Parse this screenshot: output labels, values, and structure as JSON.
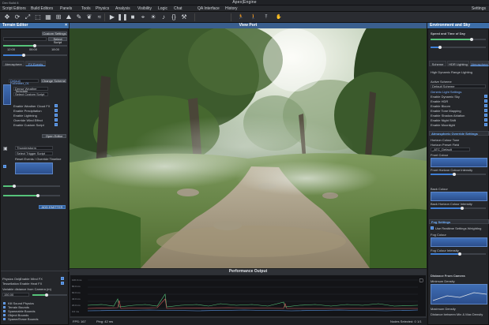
{
  "window": {
    "left_label": "Dev Build 8",
    "title": "Apex|Engine"
  },
  "menu": [
    "Script Editors",
    "Build Editors",
    "Panels",
    "Tools",
    "Physics",
    "Analysis",
    "Visibility",
    "Logic",
    "Chat",
    "QA Interface",
    "History"
  ],
  "menu_right": "Settings",
  "toolbar_icons": [
    "move-icon",
    "rotate-icon",
    "scale-icon",
    "select-icon",
    "grid-icon",
    "snap-icon",
    "terrain-icon",
    "paint-icon",
    "foliage-icon",
    "water-icon",
    "play-icon",
    "pause-icon",
    "stop-icon",
    "camera-icon",
    "light-icon",
    "sound-icon",
    "script-icon",
    "build-icon",
    "figure-run-icon",
    "figure-walk-icon",
    "figure-jump-icon",
    "figure-pose-icon"
  ],
  "left_panel": {
    "title": "Terrain Editor",
    "custom_settings": "Custom Settings",
    "select_script": "Select Script",
    "time_labels": [
      "12:00",
      "06:00",
      "18:00"
    ],
    "tabs": [
      "Atmosphere",
      "FX Events"
    ],
    "default_field": "Default FxEmitter_01",
    "change_scheme": "Change Scheme",
    "fields": [
      "Dense Weather Template",
      "Select Custom Script"
    ],
    "checkboxes": [
      "Enable Weather Cloud FX",
      "Enable Precipitation",
      "Enable Lightning",
      "Override Wind Effect",
      "Enable Custom Script"
    ],
    "open_editor": "Open Editor",
    "params": [
      "Thunderstorm",
      "Select Trigger Script",
      "Reset Events / Override Timeline"
    ],
    "apply_button": "ADD EMITTER",
    "bottom_checks": [
      "Enable Wind FX",
      "Enable Heat FX"
    ],
    "bottom_items": [
      "Physics Only",
      "Tessellation",
      "Variable distance from Camera (m)"
    ],
    "distance_value": "150.00",
    "toggle_items": [
      "Kill Sound Physics",
      "Terrain Bounds",
      "Spawnable Bounds",
      "Object Bounds",
      "Spawn/Erase Bounds"
    ]
  },
  "viewport": {
    "title": "View Port"
  },
  "performance": {
    "title": "Performance Output",
    "y_labels": [
      "100.0 ms",
      "80.0 ms",
      "60.0 ms",
      "40.0 ms",
      "20.0 ms",
      "0.0 ms"
    ],
    "fps": "FPS: 167",
    "ping": "Ping: 42 ms",
    "nodes": "Nodes Selected: 0",
    "page": "1/1"
  },
  "right_panel": {
    "title": "Environment and Sky",
    "speed": "Speed and Time of Day",
    "tabs": [
      "Scheme",
      "HDR Lighting",
      "Atmosphere"
    ],
    "hdr_title": "High Dynamic Range Lighting",
    "active_scheme": "Active Scheme",
    "scheme_value": "Default Scheme",
    "generic_title": "Generic Light Settings",
    "generic_items": [
      "Enable Dynamic Sky",
      "Enable HDR",
      "Enable Bloom",
      "Enable Tone Mapping",
      "Enable Shadow Ablation",
      "Enable Night Shift",
      "Enable Moonlight"
    ],
    "atmo_title": "Atmospheric Override Settings",
    "horizon_tone": "Horizon Colour Tone",
    "horizon_preset": "Horizon Preset Field",
    "horizon_value": "_ATC_Default",
    "front_colour": "Front Colour",
    "front_intensity": "Front Horizon Colour Intensity",
    "back_colour": "Back Colour",
    "back_intensity": "Back Horizon Colour Intensity",
    "fog_title": "Fog Settings",
    "fog_items": [
      "Use Realtime Settings Weighting",
      "Fog Colour",
      "Fog Colour Intensity",
      "Distance From Camera",
      "Minimum Density",
      "Maximum Density",
      "Distance between Min & Max Density"
    ]
  },
  "colors": {
    "accent": "#3d6ea8",
    "highlight": "#5a9cf0"
  }
}
